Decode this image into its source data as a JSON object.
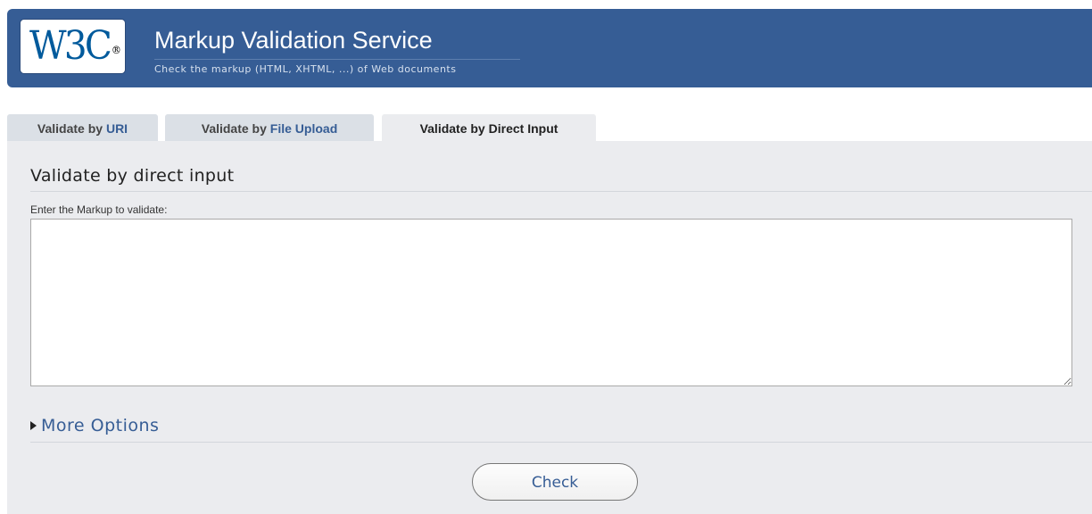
{
  "banner": {
    "logo_text": "W3C",
    "logo_mark": "®",
    "title": "Markup Validation Service",
    "subtitle": "Check the markup (HTML, XHTML, ...) of Web documents"
  },
  "tabs": [
    {
      "prefix": "Validate by ",
      "accent": "URI",
      "active": false
    },
    {
      "prefix": "Validate by ",
      "accent": "File Upload",
      "active": false
    },
    {
      "prefix": "Validate by ",
      "accent": "Direct Input",
      "active": true
    }
  ],
  "direct_input": {
    "heading": "Validate by direct input",
    "field_label": "Enter the Markup to validate:",
    "field_value": "",
    "more_options_label": "More Options",
    "check_label": "Check"
  },
  "colors": {
    "banner": "#365d95",
    "panel": "#ebecef",
    "link": "#365d95",
    "inactive_tab": "#dbe0e6"
  },
  "icons": {
    "more_options": "triangle-right-icon",
    "logo": "w3c-logo"
  }
}
